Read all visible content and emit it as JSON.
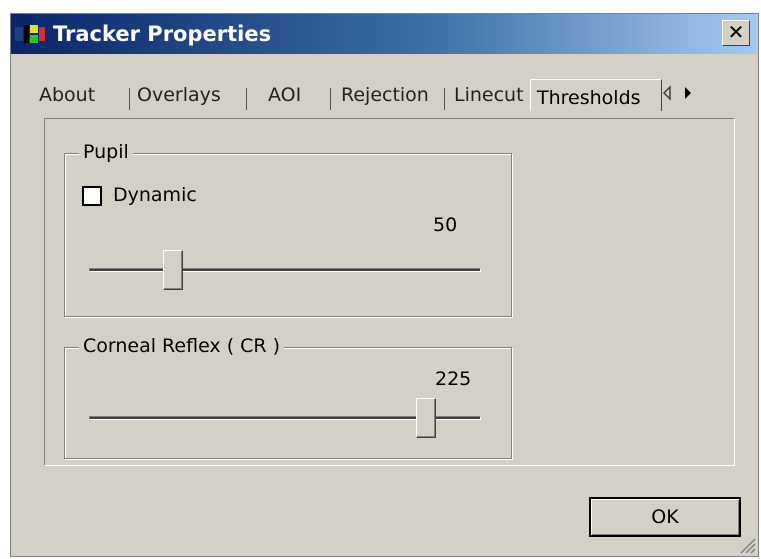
{
  "window": {
    "title": "Tracker Properties",
    "close_glyph": "✕"
  },
  "tabs": {
    "items": [
      "About",
      "Overlays",
      "AOI",
      "Rejection",
      "Linecut"
    ],
    "active": "Thresholds",
    "scroll_left_icon": "arrow-left-icon",
    "scroll_right_icon": "arrow-right-icon"
  },
  "pupil": {
    "group_label": "Pupil",
    "dynamic_label": "Dynamic",
    "dynamic_checked": false,
    "value": "50",
    "slider_fraction": 0.2
  },
  "cr": {
    "group_label": "Corneal Reflex ( CR )",
    "value": "225",
    "slider_fraction": 0.88
  },
  "buttons": {
    "ok_label": "OK"
  },
  "colors": {
    "title_start": "#0a246a",
    "title_end": "#a6caf0",
    "face": "#d4d0c8"
  }
}
